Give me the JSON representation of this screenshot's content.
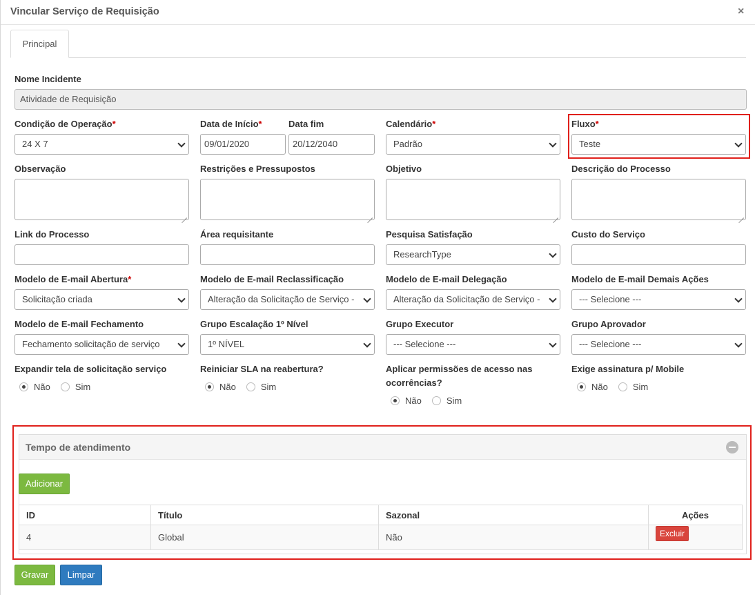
{
  "modal": {
    "title": "Vincular Serviço de Requisição",
    "close": "×"
  },
  "tabs": [
    {
      "label": "Principal"
    }
  ],
  "form": {
    "nome_incidente": {
      "label": "Nome Incidente",
      "value": "Atividade de Requisição"
    },
    "condicao": {
      "label": "Condição de Operação",
      "required": "*",
      "value": "24 X 7"
    },
    "data_inicio": {
      "label": "Data de Início",
      "required": "*",
      "value": "09/01/2020"
    },
    "data_fim": {
      "label": "Data fim",
      "value": "20/12/2040"
    },
    "calendario": {
      "label": "Calendário",
      "required": "*",
      "value": "Padrão"
    },
    "fluxo": {
      "label": "Fluxo",
      "required": "*",
      "value": "Teste"
    },
    "observacao": {
      "label": "Observação"
    },
    "restricoes": {
      "label": "Restrições e Pressupostos"
    },
    "objetivo": {
      "label": "Objetivo"
    },
    "descricao": {
      "label": "Descrição do Processo"
    },
    "link": {
      "label": "Link do Processo"
    },
    "area": {
      "label": "Área requisitante"
    },
    "pesquisa": {
      "label": "Pesquisa Satisfação",
      "value": "ResearchType"
    },
    "custo": {
      "label": "Custo do Serviço"
    },
    "email_abertura": {
      "label": "Modelo de E-mail Abertura",
      "required": "*",
      "value": "Solicitação criada"
    },
    "email_reclass": {
      "label": "Modelo de E-mail Reclassificação",
      "value": "Alteração da Solicitação de Serviço -"
    },
    "email_deleg": {
      "label": "Modelo de E-mail Delegação",
      "value": "Alteração da Solicitação de Serviço -"
    },
    "email_demais": {
      "label": "Modelo de E-mail Demais Ações",
      "value": "--- Selecione ---"
    },
    "email_fech": {
      "label": "Modelo de E-mail Fechamento",
      "value": "Fechamento solicitação de serviço"
    },
    "grupo_escal": {
      "label": "Grupo Escalação 1º Nível",
      "value": "1º NÍVEL"
    },
    "grupo_exec": {
      "label": "Grupo Executor",
      "value": "--- Selecione ---"
    },
    "grupo_aprov": {
      "label": "Grupo Aprovador",
      "value": "--- Selecione ---"
    },
    "expandir": {
      "label": "Expandir tela de solicitação serviço",
      "opt_no": "Não",
      "opt_yes": "Sim",
      "selected": "Não"
    },
    "reiniciar": {
      "label": "Reiniciar SLA na reabertura?",
      "opt_no": "Não",
      "opt_yes": "Sim",
      "selected": "Não"
    },
    "aplicar": {
      "label_1": "Aplicar permissões de acesso nas",
      "label_2": "ocorrências?",
      "opt_no": "Não",
      "opt_yes": "Sim",
      "selected": "Não"
    },
    "assinatura": {
      "label": "Exige assinatura p/ Mobile",
      "opt_no": "Não",
      "opt_yes": "Sim",
      "selected": "Não"
    }
  },
  "tempo": {
    "title": "Tempo de atendimento",
    "add_label": "Adicionar",
    "columns": [
      "ID",
      "Título",
      "Sazonal",
      "Ações"
    ],
    "rows": [
      {
        "id": "4",
        "titulo": "Global",
        "sazonal": "Não",
        "acao": "Excluir"
      }
    ]
  },
  "footer": {
    "save": "Gravar",
    "clear": "Limpar"
  },
  "colors": {
    "highlight": "#e0201b",
    "green": "#7cb940",
    "blue": "#2f7bbf",
    "red": "#d9453d",
    "required": "#cc0000"
  }
}
